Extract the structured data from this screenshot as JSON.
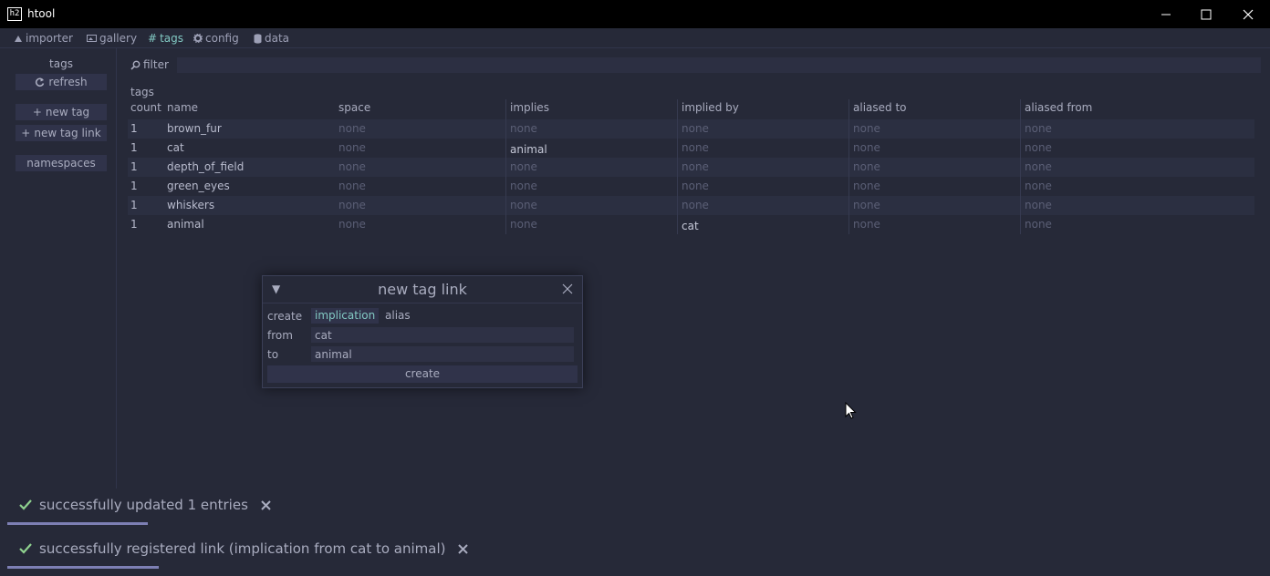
{
  "window": {
    "icon_text": "h2",
    "title": "htool"
  },
  "menu": [
    {
      "label": "importer",
      "icon": "importer-icon"
    },
    {
      "label": "gallery",
      "icon": "image-icon"
    },
    {
      "label": "tags",
      "icon": "hash-icon"
    },
    {
      "label": "config",
      "icon": "gear-icon"
    },
    {
      "label": "data",
      "icon": "database-icon"
    }
  ],
  "sidebar": {
    "title": "tags",
    "refresh": "refresh",
    "new_tag": "new tag",
    "new_tag_link": "new tag link",
    "namespaces": "namespaces"
  },
  "filter": {
    "label": "filter",
    "value": ""
  },
  "table": {
    "caption": "tags",
    "columns": [
      "count",
      "name",
      "space",
      "implies",
      "implied by",
      "aliased to",
      "aliased from"
    ],
    "rows": [
      {
        "count": "1",
        "name": "brown_fur",
        "space": "none",
        "implies": "none",
        "implied_by": "none",
        "aliased_to": "none",
        "aliased_from": "none"
      },
      {
        "count": "1",
        "name": "cat",
        "space": "none",
        "implies": "animal",
        "implied_by": "none",
        "aliased_to": "none",
        "aliased_from": "none"
      },
      {
        "count": "1",
        "name": "depth_of_field",
        "space": "none",
        "implies": "none",
        "implied_by": "none",
        "aliased_to": "none",
        "aliased_from": "none"
      },
      {
        "count": "1",
        "name": "green_eyes",
        "space": "none",
        "implies": "none",
        "implied_by": "none",
        "aliased_to": "none",
        "aliased_from": "none"
      },
      {
        "count": "1",
        "name": "whiskers",
        "space": "none",
        "implies": "none",
        "implied_by": "none",
        "aliased_to": "none",
        "aliased_from": "none"
      },
      {
        "count": "1",
        "name": "animal",
        "space": "none",
        "implies": "none",
        "implied_by": "cat",
        "aliased_to": "none",
        "aliased_from": "none"
      }
    ]
  },
  "dialog": {
    "title": "new tag link",
    "create_label": "create",
    "options": [
      "implication",
      "alias"
    ],
    "selected_option": "implication",
    "from_label": "from",
    "from_value": "cat",
    "to_label": "to",
    "to_value": "animal",
    "create_button": "create"
  },
  "toasts": [
    {
      "message": "successfully updated 1 entries",
      "progress": 0.11
    },
    {
      "message": "successfully registered link (implication from cat to animal)",
      "progress": 0.12
    }
  ],
  "colors": {
    "background": "#262938",
    "accent": "#82c9c3",
    "muted": "#5b5f76",
    "success": "#8fd18f",
    "toast_bar": "#7d7fb4"
  }
}
